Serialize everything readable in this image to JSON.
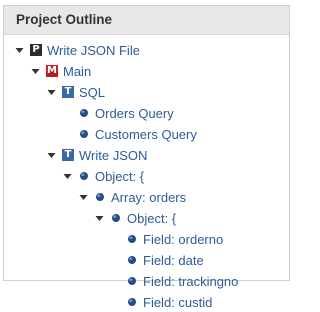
{
  "panel": {
    "title": "Project Outline"
  },
  "tree": [
    {
      "label": "Write JSON File",
      "icon": "P",
      "icon_name": "project-icon",
      "expanded": true,
      "depth": 0
    },
    {
      "label": "Main",
      "icon": "M",
      "icon_name": "module-icon",
      "expanded": true,
      "depth": 1
    },
    {
      "label": "SQL",
      "icon": "T",
      "icon_name": "task-icon",
      "expanded": true,
      "depth": 2
    },
    {
      "label": "Orders Query",
      "icon": "dot",
      "icon_name": "node-dot-icon",
      "depth": 3
    },
    {
      "label": "Customers Query",
      "icon": "dot",
      "icon_name": "node-dot-icon",
      "depth": 3
    },
    {
      "label": "Write JSON",
      "icon": "T",
      "icon_name": "task-icon",
      "expanded": true,
      "depth": 2
    },
    {
      "label": "Object: {",
      "icon": "dot",
      "icon_name": "node-dot-icon",
      "expanded": true,
      "depth": 3
    },
    {
      "label": "Array: orders",
      "icon": "dot",
      "icon_name": "node-dot-icon",
      "expanded": true,
      "depth": 4
    },
    {
      "label": "Object: {",
      "icon": "dot",
      "icon_name": "node-dot-icon",
      "expanded": true,
      "depth": 5
    },
    {
      "label": "Field: orderno",
      "icon": "dot",
      "icon_name": "node-dot-icon",
      "depth": 6
    },
    {
      "label": "Field: date",
      "icon": "dot",
      "icon_name": "node-dot-icon",
      "depth": 6
    },
    {
      "label": "Field: trackingno",
      "icon": "dot",
      "icon_name": "node-dot-icon",
      "depth": 6
    },
    {
      "label": "Field: custid",
      "icon": "dot",
      "icon_name": "node-dot-icon",
      "depth": 6
    }
  ]
}
